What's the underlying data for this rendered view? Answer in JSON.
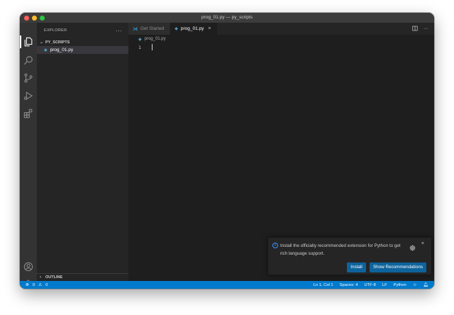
{
  "window": {
    "title": "prog_01.py — py_scripts"
  },
  "sidebar": {
    "header": "EXPLORER",
    "more": "···",
    "folder": "PY_SCRIPTS",
    "file": "prog_01.py",
    "outline": "OUTLINE"
  },
  "tabs": [
    {
      "label": "Get Started",
      "active": false
    },
    {
      "label": "prog_01.py",
      "active": true,
      "close": "×"
    }
  ],
  "breadcrumb": "prog_01.py",
  "editor": {
    "line_number": "1"
  },
  "notification": {
    "message": "Install the officially recommended extension for Python to get rich language support.",
    "install_label": "Install",
    "recommend_label": "Show Recommendations",
    "close": "×"
  },
  "statusbar": {
    "errors": "0",
    "warnings": "0",
    "position": "Ln 1, Col 1",
    "spaces": "Spaces: 4",
    "encoding": "UTF-8",
    "eol": "LF",
    "language": "Python"
  },
  "colors": {
    "accent": "#007acc",
    "button": "#0e639c",
    "editor_bg": "#1e1e1e",
    "sidebar_bg": "#252526",
    "activitybar_bg": "#333333",
    "python_icon": "#519aba"
  }
}
